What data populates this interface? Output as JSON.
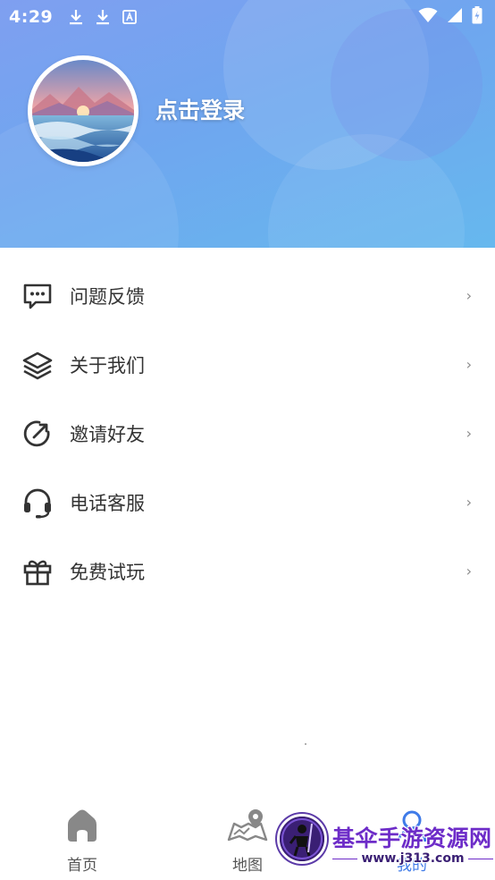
{
  "status_bar": {
    "time": "4:29"
  },
  "profile": {
    "login_label": "点击登录"
  },
  "menu": {
    "items": [
      {
        "label": "问题反馈",
        "icon": "message-dots-icon",
        "arrow": "›"
      },
      {
        "label": "关于我们",
        "icon": "layers-icon",
        "arrow": "›"
      },
      {
        "label": "邀请好友",
        "icon": "share-arrow-icon",
        "arrow": "›"
      },
      {
        "label": "电话客服",
        "icon": "headset-icon",
        "arrow": "›"
      },
      {
        "label": "免费试玩",
        "icon": "gift-icon",
        "arrow": "›"
      }
    ]
  },
  "tabbar": {
    "tabs": [
      {
        "label": "首页",
        "icon": "home-icon",
        "active": false
      },
      {
        "label": "地图",
        "icon": "map-icon",
        "active": false
      },
      {
        "label": "我的",
        "icon": "profile-icon",
        "active": true
      }
    ]
  },
  "watermark": {
    "title": "基伞手游资源网",
    "url": "www.j313.com"
  },
  "colors": {
    "header_gradient_start": "#7f9ff0",
    "header_gradient_end": "#66b8ee",
    "active_tab": "#3f7be8",
    "menu_text": "#333333",
    "icon": "#333333"
  }
}
